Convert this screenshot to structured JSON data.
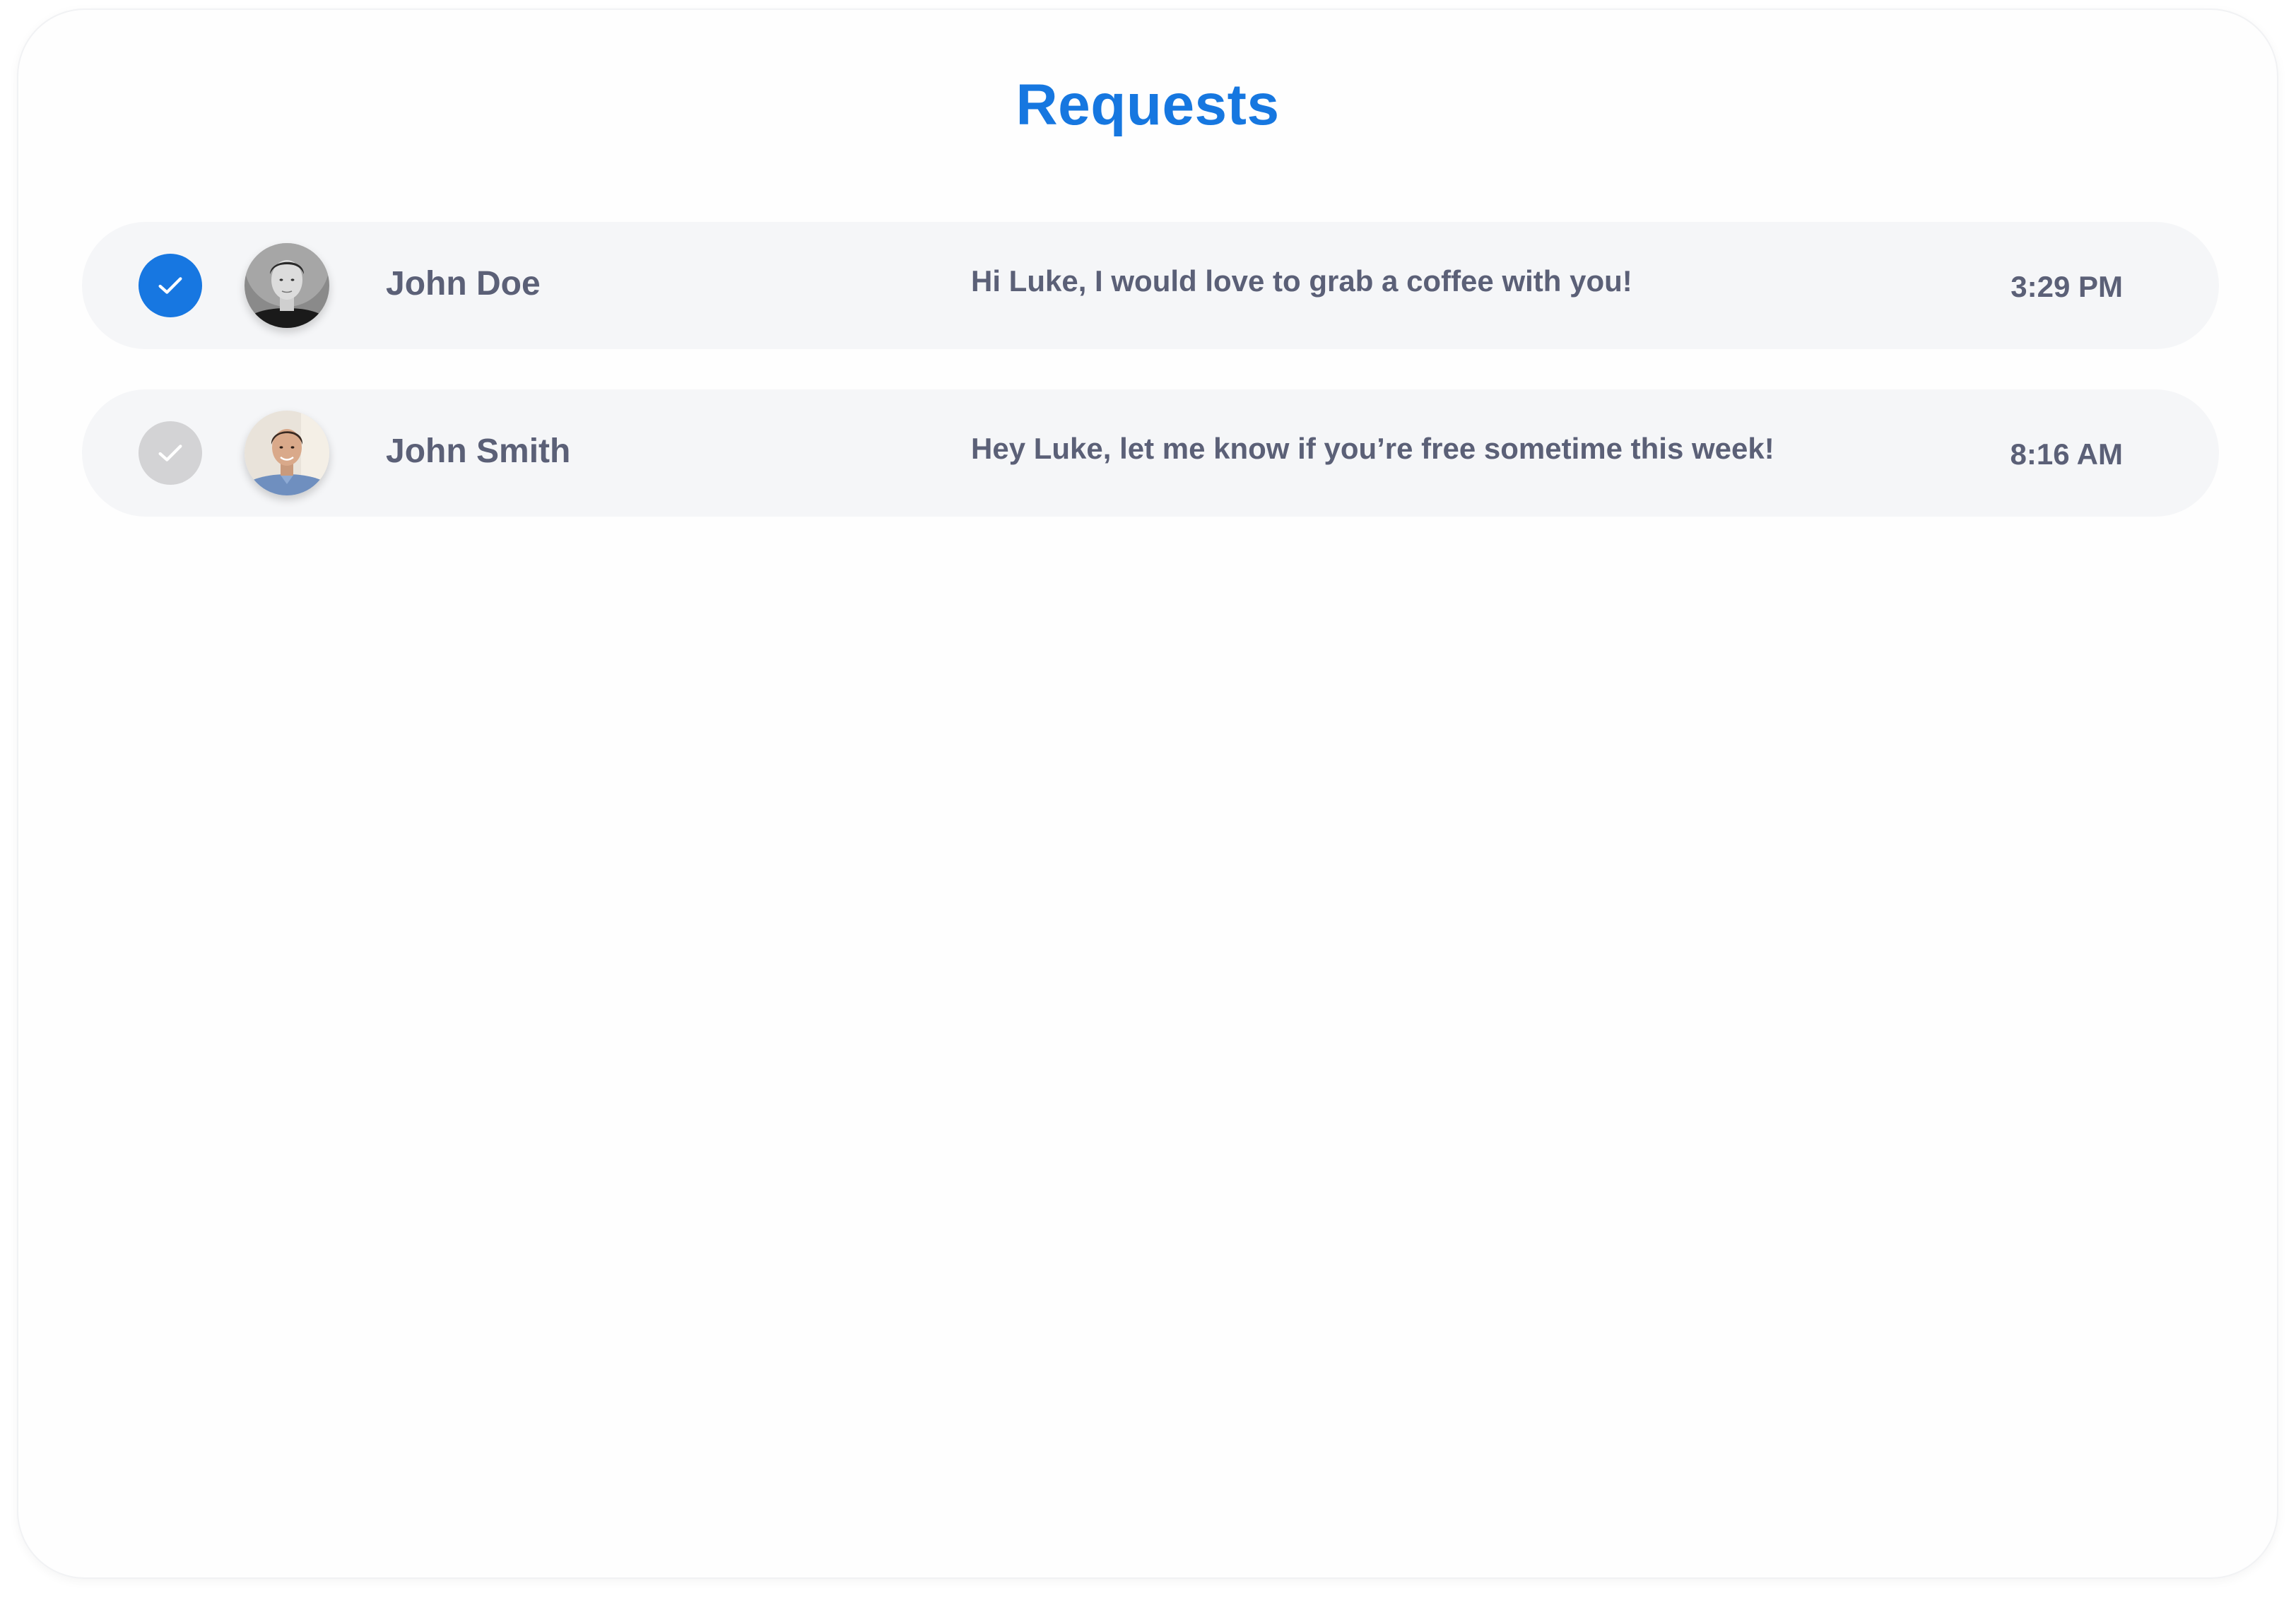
{
  "page": {
    "title": "Requests"
  },
  "colors": {
    "accent": "#1777e1",
    "title": "#1677e0",
    "row_background": "#f5f6f8",
    "text": "#5b6077",
    "unchecked": "#d3d3d5"
  },
  "requests": [
    {
      "name": "John Doe",
      "message": "Hi Luke, I would love to grab a coffee with you!",
      "time": "3:29 PM",
      "selected": true,
      "avatar_icon": "person-photo-bw"
    },
    {
      "name": "John Smith",
      "message": "Hey Luke, let me know if you’re free sometime this week!",
      "time": "8:16 AM",
      "selected": false,
      "avatar_icon": "person-photo-color"
    }
  ]
}
